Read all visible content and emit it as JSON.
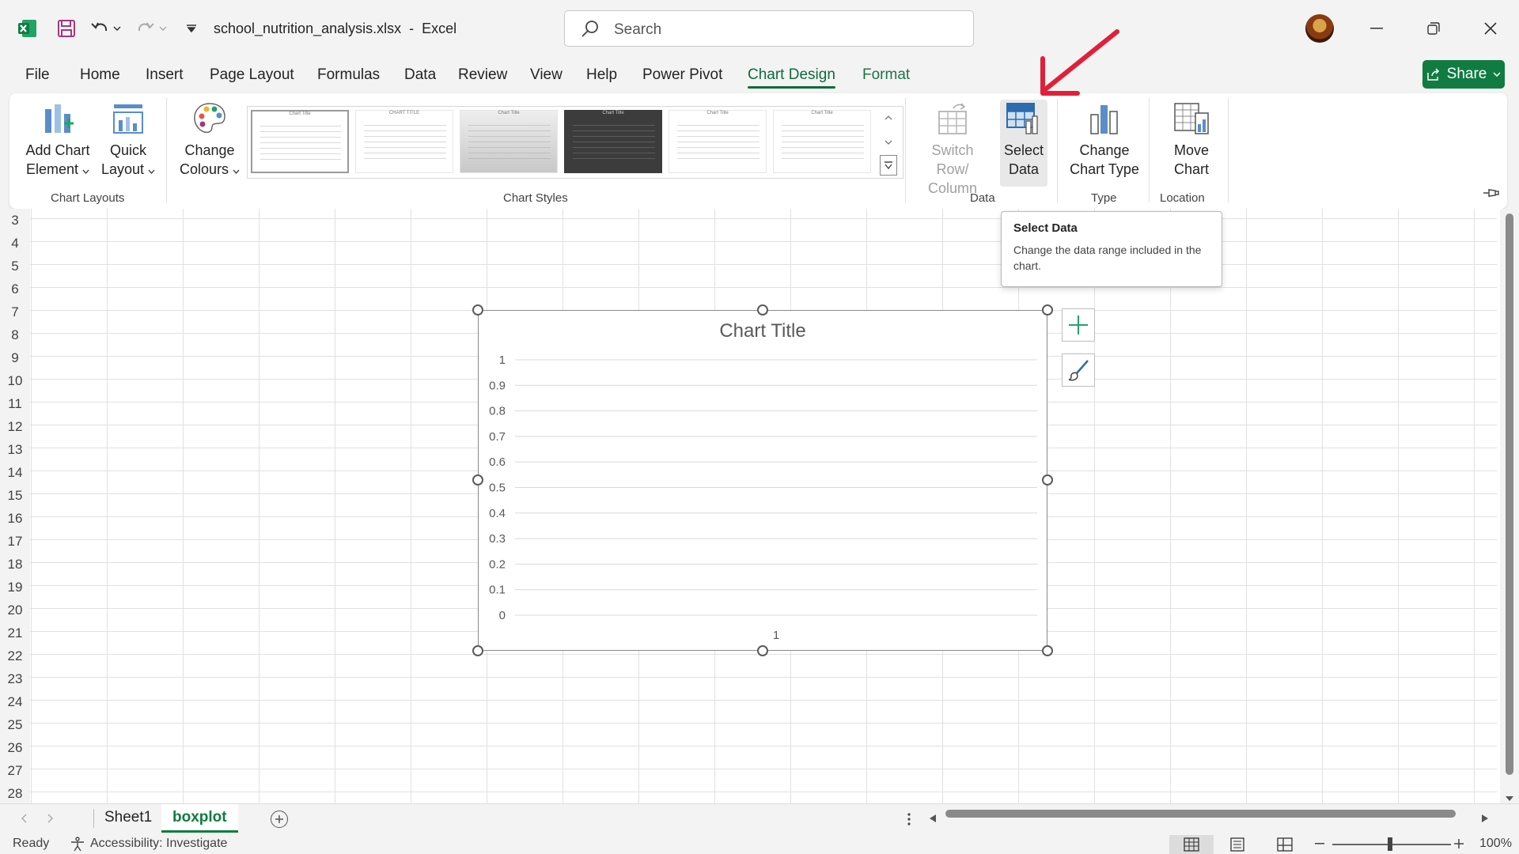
{
  "titlebar": {
    "filename": "school_nutrition_analysis.xlsx",
    "app": "Excel",
    "search_placeholder": "Search"
  },
  "menu": {
    "tabs": [
      "File",
      "Home",
      "Insert",
      "Page Layout",
      "Formulas",
      "Data",
      "Review",
      "View",
      "Help",
      "Power Pivot",
      "Chart Design",
      "Format"
    ],
    "active": "Chart Design",
    "share_label": "Share"
  },
  "ribbon": {
    "add_chart_element": [
      "Add Chart",
      "Element"
    ],
    "quick_layout": [
      "Quick",
      "Layout"
    ],
    "change_colours": [
      "Change",
      "Colours"
    ],
    "switch_row_column": [
      "Switch Row/",
      "Column"
    ],
    "select_data": [
      "Select",
      "Data"
    ],
    "change_chart_type": [
      "Change",
      "Chart Type"
    ],
    "move_chart": [
      "Move",
      "Chart"
    ],
    "groups": {
      "chart_layouts": "Chart Layouts",
      "chart_styles": "Chart Styles",
      "data": "Data",
      "type": "Type",
      "location": "Location"
    },
    "style_thumb_titles": [
      "Chart Title",
      "CHART TITLE",
      "Chart Title",
      "Chart Title",
      "Chart Title",
      "Chart Title"
    ]
  },
  "tooltip": {
    "title": "Select Data",
    "description": "Change the data range included in the chart."
  },
  "sheet": {
    "row_numbers": [
      "3",
      "4",
      "5",
      "6",
      "7",
      "8",
      "9",
      "10",
      "11",
      "12",
      "13",
      "14",
      "15",
      "16",
      "17",
      "18",
      "19",
      "20",
      "21",
      "22",
      "23",
      "24",
      "25",
      "26",
      "27",
      "28"
    ]
  },
  "chart_data": {
    "type": "bar",
    "title": "Chart Title",
    "categories": [
      "1"
    ],
    "series": [],
    "ylim": [
      0,
      1
    ],
    "y_ticks": [
      "1",
      "0.9",
      "0.8",
      "0.7",
      "0.6",
      "0.5",
      "0.4",
      "0.3",
      "0.2",
      "0.1",
      "0"
    ],
    "grid": true
  },
  "sheet_tabs": {
    "tabs": [
      "Sheet1",
      "boxplot"
    ],
    "active": "boxplot"
  },
  "status": {
    "ready": "Ready",
    "accessibility": "Accessibility: Investigate",
    "zoom": "100%"
  },
  "colors": {
    "accent_green": "#107c41",
    "annotation_arrow": "#e0203a"
  }
}
